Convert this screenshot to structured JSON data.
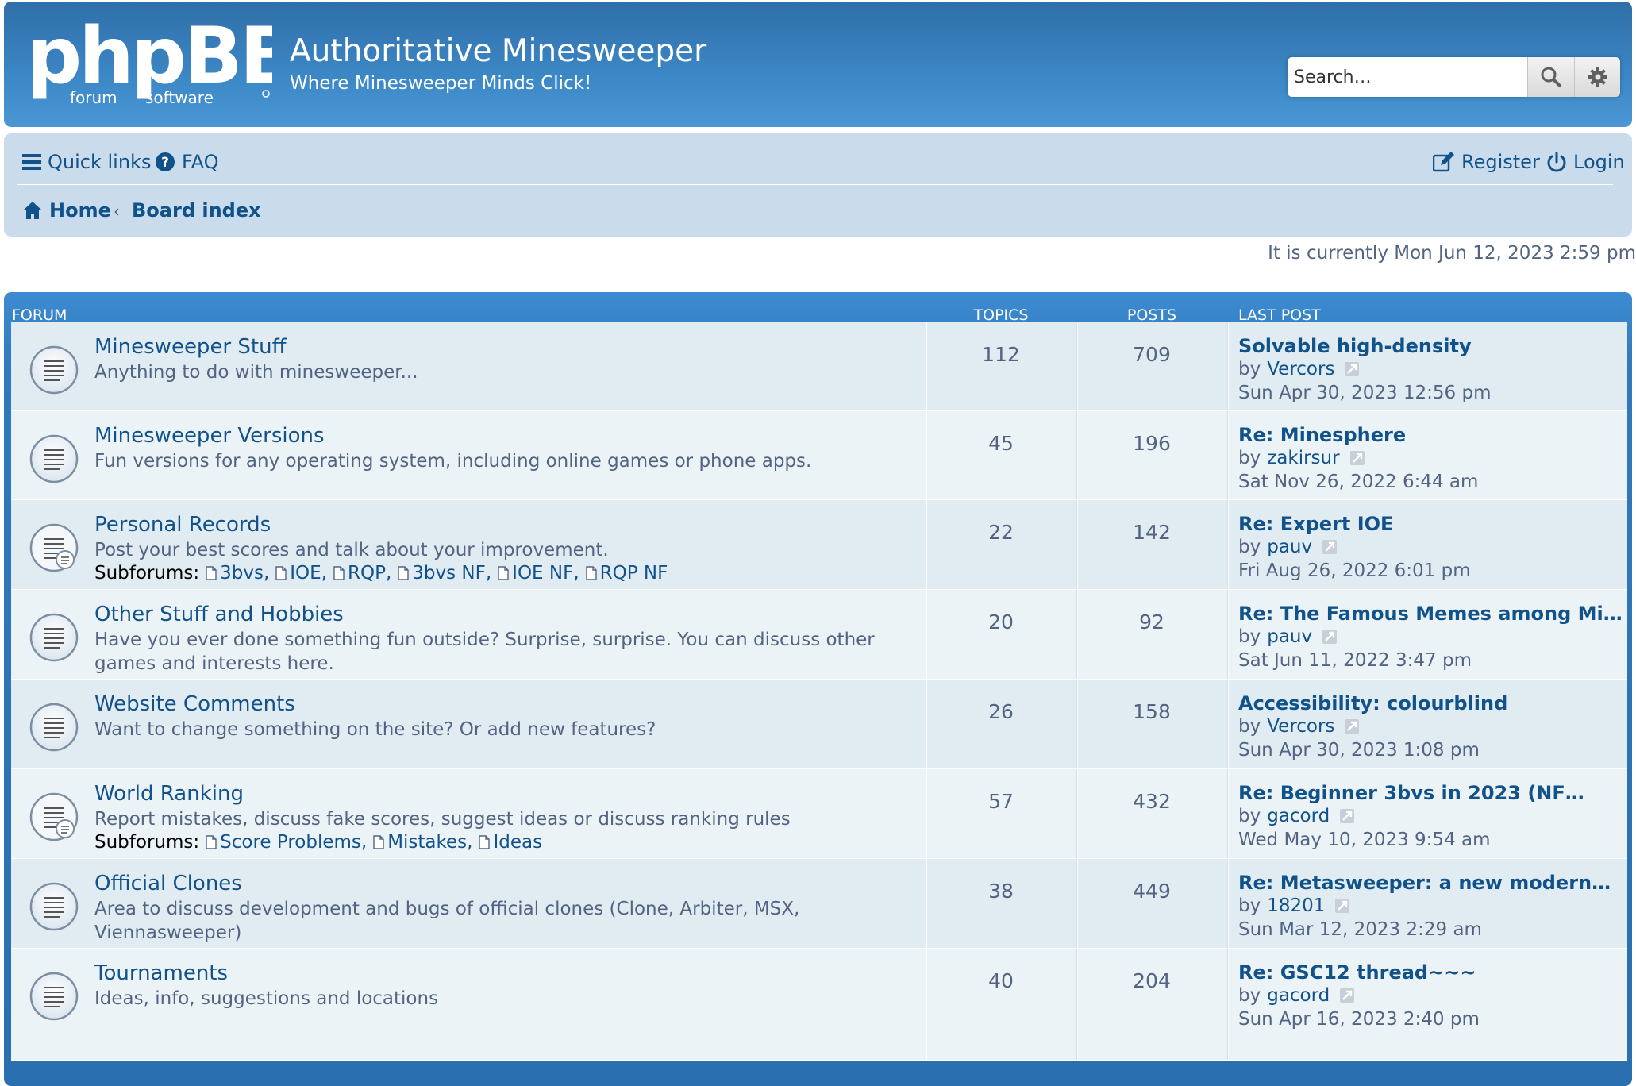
{
  "header": {
    "logo_main": "phpBB",
    "logo_sub_left": "forum",
    "logo_sub_right": "software",
    "site_title": "Authoritative Minesweeper",
    "site_description": "Where Minesweeper Minds Click!",
    "search_placeholder": "Search…",
    "colors": {
      "header_bg": "#3c87c6",
      "link": "#105289",
      "navbar_bg": "#cadceb"
    }
  },
  "navbar": {
    "quick_links": "Quick links",
    "faq": "FAQ",
    "register": "Register",
    "login": "Login",
    "breadcrumbs": [
      "Home",
      "Board index"
    ]
  },
  "current_time": "It is currently Mon Jun 12, 2023 2:59 pm",
  "list_header": {
    "forum": "Forum",
    "topics": "Topics",
    "posts": "Posts",
    "last_post": "Last post"
  },
  "subforums_label": "Subforums:",
  "by_label": "by",
  "forums": [
    {
      "title": "Minesweeper Stuff",
      "description": "Anything to do with minesweeper...",
      "topics": "112",
      "posts": "709",
      "last_post": {
        "title": "Solvable high-density",
        "user": "Vercors",
        "date": "Sun Apr 30, 2023 12:56 pm"
      }
    },
    {
      "title": "Minesweeper Versions",
      "description": "Fun versions for any operating system, including online games or phone apps.",
      "topics": "45",
      "posts": "196",
      "last_post": {
        "title": "Re: Minesphere",
        "user": "zakirsur",
        "date": "Sat Nov 26, 2022 6:44 am"
      }
    },
    {
      "title": "Personal Records",
      "description": "Post your best scores and talk about your improvement.",
      "subforums": [
        "3bvs,",
        "IOE,",
        "RQP,",
        "3bvs NF,",
        "IOE NF,",
        "RQP NF"
      ],
      "topics": "22",
      "posts": "142",
      "last_post": {
        "title": "Re: Expert IOE",
        "user": "pauv",
        "date": "Fri Aug 26, 2022 6:01 pm"
      }
    },
    {
      "title": "Other Stuff and Hobbies",
      "description": "Have you ever done something fun outside? Surprise, surprise. You can discuss other games and interests here.",
      "topics": "20",
      "posts": "92",
      "last_post": {
        "title": "Re: The Famous Memes among Mi…",
        "user": "pauv",
        "date": "Sat Jun 11, 2022 3:47 pm"
      }
    },
    {
      "title": "Website Comments",
      "description": "Want to change something on the site? Or add new features?",
      "topics": "26",
      "posts": "158",
      "last_post": {
        "title": "Accessibility: colourblind",
        "user": "Vercors",
        "date": "Sun Apr 30, 2023 1:08 pm"
      }
    },
    {
      "title": "World Ranking",
      "description": "Report mistakes, discuss fake scores, suggest ideas or discuss ranking rules",
      "subforums": [
        "Score Problems,",
        "Mistakes,",
        "Ideas"
      ],
      "topics": "57",
      "posts": "432",
      "last_post": {
        "title": "Re: Beginner 3bvs in 2023 (NF…",
        "user": "gacord",
        "date": "Wed May 10, 2023 9:54 am"
      }
    },
    {
      "title": "Official Clones",
      "description": "Area to discuss development and bugs of official clones (Clone, Arbiter, MSX, Viennasweeper)",
      "topics": "38",
      "posts": "449",
      "last_post": {
        "title": "Re: Metasweeper: a new modern…",
        "user": "18201",
        "date": "Sun Mar 12, 2023 2:29 am"
      }
    },
    {
      "title": "Tournaments",
      "description": "Ideas, info, suggestions and locations",
      "topics": "40",
      "posts": "204",
      "last_post": {
        "title": "Re: GSC12 thread~~~",
        "user": "gacord",
        "date": "Sun Apr 16, 2023 2:40 pm"
      }
    }
  ]
}
